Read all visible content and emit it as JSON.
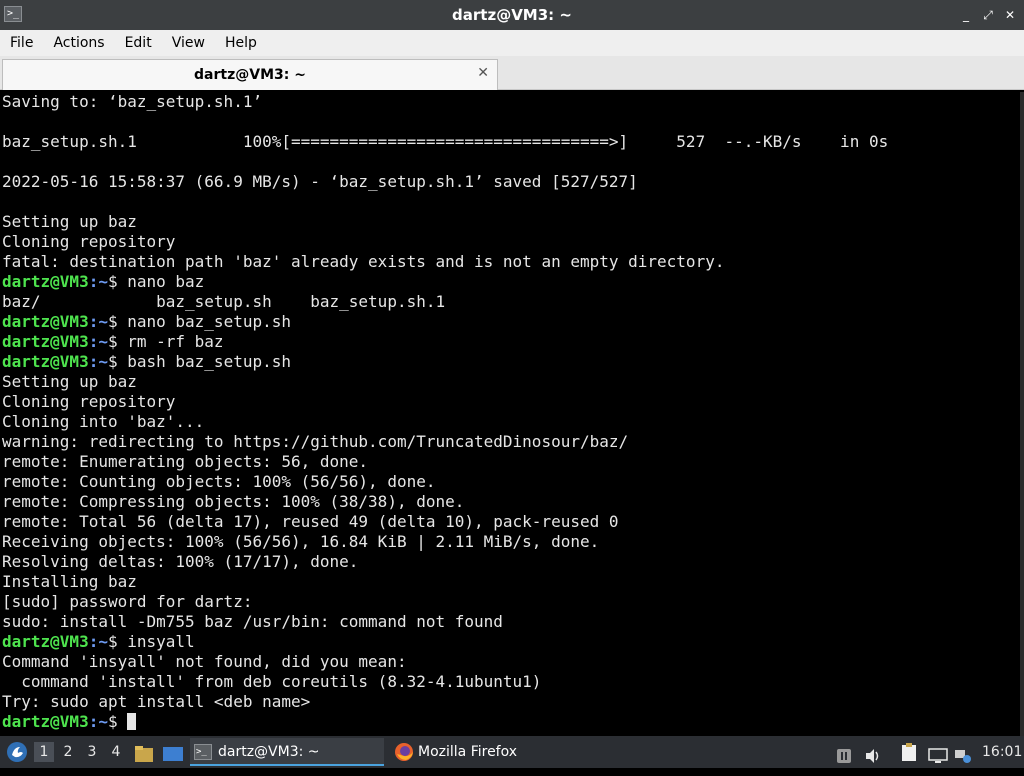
{
  "window": {
    "title": "dartz@VM3: ~",
    "controls": [
      "_",
      "⤢",
      "✕"
    ]
  },
  "menu": [
    "File",
    "Actions",
    "Edit",
    "View",
    "Help"
  ],
  "tab": {
    "label": "dartz@VM3: ~",
    "close": "✕"
  },
  "terminal": {
    "user_host": "dartz@VM3",
    "path": ":~",
    "prompt_symbol": "$ ",
    "lines": [
      "Saving to: ‘baz_setup.sh.1’",
      "",
      "baz_setup.sh.1           100%[=================================>]     527  --.-KB/s    in 0s",
      "",
      "2022-05-16 15:58:37 (66.9 MB/s) - ‘baz_setup.sh.1’ saved [527/527]",
      "",
      "Setting up baz",
      "Cloning repository",
      "fatal: destination path 'baz' already exists and is not an empty directory.",
      "nano baz",
      "baz/            baz_setup.sh    baz_setup.sh.1",
      "nano baz_setup.sh",
      "rm -rf baz",
      "bash baz_setup.sh",
      "Setting up baz",
      "Cloning repository",
      "Cloning into 'baz'...",
      "warning: redirecting to https://github.com/TruncatedDinosour/baz/",
      "remote: Enumerating objects: 56, done.",
      "remote: Counting objects: 100% (56/56), done.",
      "remote: Compressing objects: 100% (38/38), done.",
      "remote: Total 56 (delta 17), reused 49 (delta 10), pack-reused 0",
      "Receiving objects: 100% (56/56), 16.84 KiB | 2.11 MiB/s, done.",
      "Resolving deltas: 100% (17/17), done.",
      "Installing baz",
      "[sudo] password for dartz:",
      "sudo: install -Dm755 baz /usr/bin: command not found",
      "insyall",
      "Command 'insyall' not found, did you mean:",
      "  command 'install' from deb coreutils (8.32-4.1ubuntu1)",
      "Try: sudo apt install <deb name>",
      ""
    ]
  },
  "taskbar": {
    "workspaces": [
      "1",
      "2",
      "3",
      "4"
    ],
    "tasks": [
      {
        "label": "dartz@VM3: ~",
        "icon": "terminal-icon"
      },
      {
        "label": "Mozilla Firefox",
        "icon": "firefox-icon"
      }
    ],
    "tray_icons": [
      "pause-icon",
      "volume-icon",
      "clipboard-icon",
      "monitor-icon",
      "network-icon"
    ],
    "clock": "16:01"
  },
  "colors": {
    "prompt_user": "#4ee44e",
    "prompt_path": "#6f9cf3",
    "terminal_bg": "#000000",
    "terminal_fg": "#e6e6e6",
    "titlebar_bg": "#3c3f41",
    "taskbar_bg": "#2b2e33"
  }
}
